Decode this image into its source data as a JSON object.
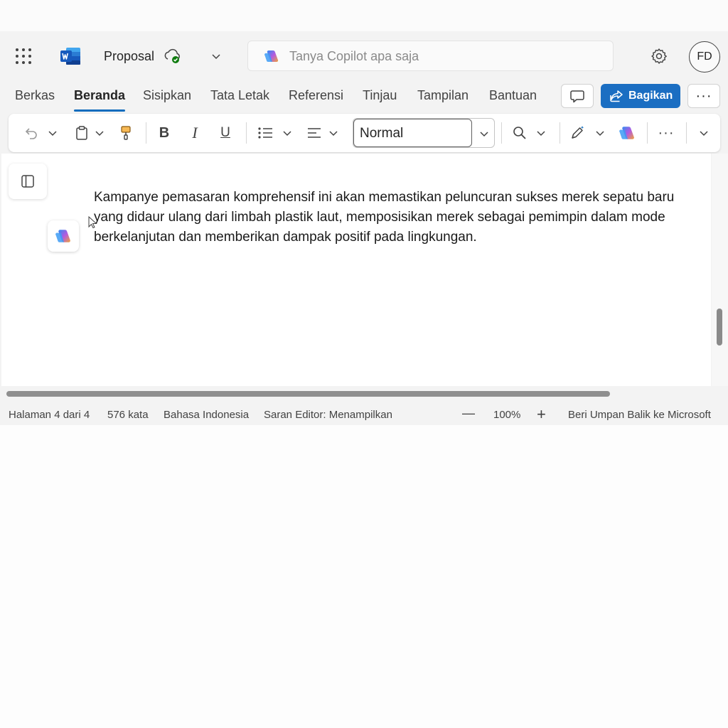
{
  "header": {
    "title": "Proposal",
    "search_placeholder": "Tanya Copilot apa saja",
    "avatar_initials": "FD"
  },
  "tabs": [
    {
      "label": "Berkas"
    },
    {
      "label": "Beranda",
      "active": true
    },
    {
      "label": "Sisipkan"
    },
    {
      "label": "Tata Letak"
    },
    {
      "label": "Referensi"
    },
    {
      "label": "Tinjau"
    },
    {
      "label": "Tampilan"
    },
    {
      "label": "Bantuan"
    }
  ],
  "actions": {
    "share_label": "Bagikan",
    "more_label": "···"
  },
  "toolbar": {
    "style_value": "Normal",
    "bold_label": "B",
    "italic_label": "I",
    "underline_label": "U",
    "more_label": "···"
  },
  "document": {
    "paragraph": "Kampanye pemasaran komprehensif ini akan memastikan peluncuran sukses merek sepatu baru yang didaur ulang dari limbah plastik laut, memposisikan merek sebagai pemimpin dalam mode berkelanjutan dan memberikan dampak positif pada lingkungan."
  },
  "status": {
    "page": "Halaman 4 dari 4",
    "words": "576 kata",
    "language": "Bahasa Indonesia",
    "editor": "Saran Editor: Menampilkan",
    "zoom_out": "—",
    "zoom": "100%",
    "zoom_in": "+",
    "feedback": "Beri Umpan Balik ke Microsoft"
  },
  "colors": {
    "accent": "#0f6cbd",
    "share_button": "#1b6ec2",
    "background": "#f3f3f3"
  },
  "icons": [
    "app-launcher-icon",
    "word-logo-icon",
    "cloud-saved-icon",
    "copilot-icon",
    "gear-icon",
    "comment-icon",
    "share-icon",
    "undo-icon",
    "clipboard-icon",
    "format-painter-icon",
    "bullets-icon",
    "align-icon",
    "find-icon",
    "designer-pen-icon",
    "copilot-icon",
    "chevron-down-icon",
    "navigation-pane-icon",
    "cursor-icon"
  ]
}
